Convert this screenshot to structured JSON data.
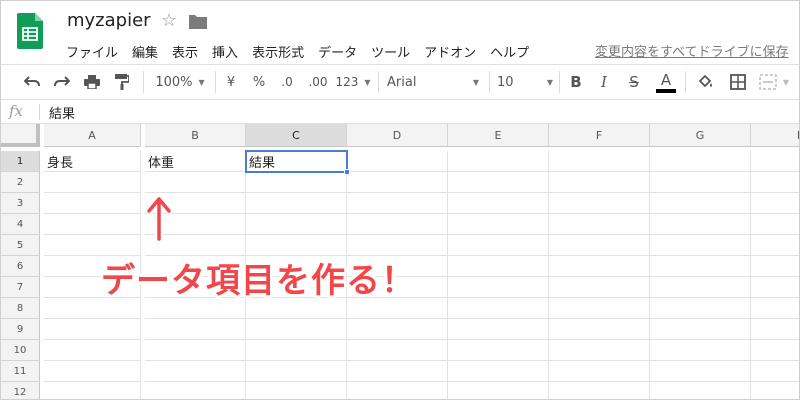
{
  "app": {
    "document_title": "myzapier",
    "save_status": "変更内容をすべてドライブに保存"
  },
  "menu": [
    "ファイル",
    "編集",
    "表示",
    "挿入",
    "表示形式",
    "データ",
    "ツール",
    "アドオン",
    "ヘルプ"
  ],
  "toolbar": {
    "zoom": "100%",
    "currency": "¥",
    "percent": "%",
    "decimal_decrease": ".0",
    "decimal_increase": ".00",
    "number_format": "123",
    "font": "Arial",
    "font_size": "10",
    "bold": "B",
    "italic": "I",
    "strikethrough": "S",
    "text_color": "A"
  },
  "formula_bar": {
    "fx": "fx",
    "value": "結果"
  },
  "sheet": {
    "columns": [
      "A",
      "B",
      "C",
      "D",
      "E",
      "F",
      "G",
      "H"
    ],
    "rows": [
      "1",
      "2",
      "3",
      "4",
      "5",
      "6",
      "7",
      "8",
      "9",
      "10",
      "11",
      "12"
    ],
    "cells": {
      "A1": "身長",
      "B1": "体重",
      "C1": "結果"
    },
    "active_cell": "C1"
  },
  "annotation": {
    "arrow": "↑",
    "text": "データ項目を作る！",
    "color": "#f0484a"
  },
  "colors": {
    "logo": "#0f9d58",
    "selection": "#4a7bd6"
  }
}
